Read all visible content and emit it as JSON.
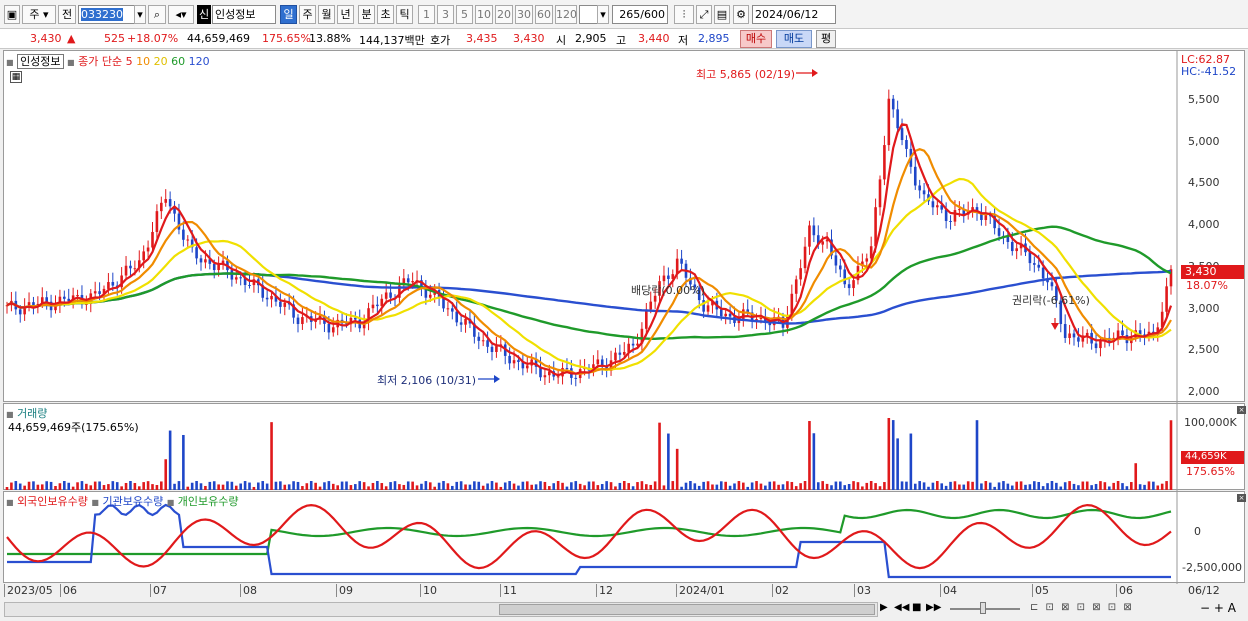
{
  "toolbar": {
    "market_label": "주",
    "prev_label": "전",
    "code_value": "033230",
    "name_badge": "신",
    "name_value": "인성정보",
    "periods": [
      "일",
      "주",
      "월",
      "년",
      "분",
      "초",
      "틱"
    ],
    "intervals": [
      "1",
      "3",
      "5",
      "10",
      "20",
      "30",
      "60",
      "120"
    ],
    "count_value": "265",
    "count_total": "/600",
    "date_value": "2024/06/12"
  },
  "quote": {
    "price": "3,430",
    "arrow": "▲",
    "change": "525",
    "change_pct": "+18.07%",
    "volume": "44,659,469",
    "volume_pct": "175.65%",
    "turnover": "13.88%",
    "amount": "144,137백만",
    "ask_label": "호가",
    "ask1": "3,435",
    "ask2": "3,430",
    "open_label": "시",
    "open": "2,905",
    "high_label": "고",
    "high": "3,440",
    "low_label": "저",
    "low": "2,895",
    "buy_label": "매수",
    "sell_label": "매도",
    "eval_label": "평"
  },
  "price_panel": {
    "title": "인성정보",
    "ma_label": "종가 단순",
    "ma_periods": [
      "5",
      "10",
      "20",
      "60",
      "120"
    ],
    "ma_colors": [
      "#e0191b",
      "#f08c00",
      "#f0e000",
      "#1f9a2a",
      "#2a4fd0"
    ],
    "lc": "LC:62.87",
    "hc": "HC:-41.52",
    "y_ticks": [
      "5,500",
      "5,000",
      "4,500",
      "4,000",
      "3,500",
      "3,000",
      "2,500",
      "2,000"
    ],
    "y_values": [
      5500,
      5000,
      4500,
      4000,
      3500,
      3000,
      2500,
      2000
    ],
    "current_price": "3,430",
    "current_pct": "18.07%",
    "high_note": "최고 5,865 (02/19)",
    "low_note": "최저 2,106 (10/31)",
    "dividend_note": "배당락(0.00%)",
    "rights_note": "권리락(-6.61%)"
  },
  "volume_panel": {
    "title": "거래량",
    "sub": "44,659,469주(175.65%)",
    "y_tick": "100,000K",
    "current": "44,659K",
    "current_pct": "175.65%"
  },
  "holding_panel": {
    "foreign": "외국인보유수량",
    "inst": "기관보유수량",
    "personal": "개인보유수량",
    "y_ticks": [
      "0",
      "-2,500,000"
    ],
    "colors": {
      "foreign": "#e0191b",
      "inst": "#2a4fd0",
      "personal": "#1f9a2a"
    }
  },
  "x_axis": {
    "labels": [
      "2023/05",
      "06",
      "07",
      "08",
      "09",
      "10",
      "11",
      "12",
      "2024/01",
      "02",
      "03",
      "04",
      "05",
      "06"
    ],
    "end_label": "06/12"
  }
}
